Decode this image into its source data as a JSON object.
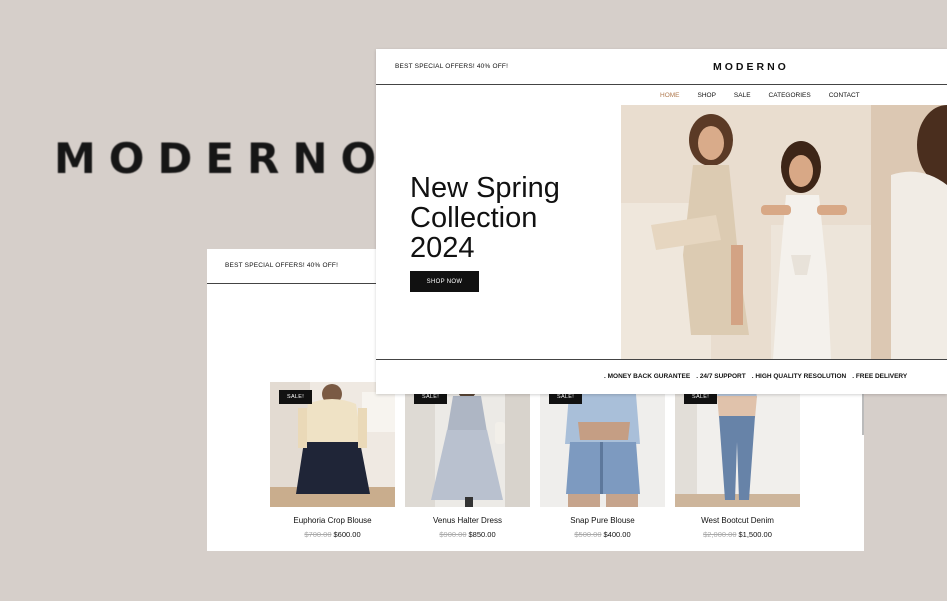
{
  "brand_logo": "MODERNO",
  "back_card": {
    "offer_text": "BEST SPECIAL OFFERS! 40% OFF!",
    "products": [
      {
        "badge": "SALE!",
        "name": "Euphoria Crop Blouse",
        "old_price": "$700.00",
        "price": "$600.00"
      },
      {
        "badge": "SALE!",
        "name": "Venus Halter Dress",
        "old_price": "$900.00",
        "price": "$850.00"
      },
      {
        "badge": "SALE!",
        "name": "Snap Pure Blouse",
        "old_price": "$500.00",
        "price": "$400.00"
      },
      {
        "badge": "SALE!",
        "name": "West Bootcut Denim",
        "old_price": "$2,000.00",
        "price": "$1,500.00"
      }
    ]
  },
  "front_card": {
    "offer_text": "BEST SPECIAL OFFERS! 40% OFF!",
    "brand": "MODERNO",
    "nav": [
      "HOME",
      "SHOP",
      "SALE",
      "CATEGORIES",
      "CONTACT"
    ],
    "nav_active": "HOME",
    "hero_title_lines": [
      "New Spring",
      "Collection",
      "2024"
    ],
    "cta_label": "SHOP NOW",
    "features": [
      ". MONEY BACK GURANTEE",
      ". 24/7 SUPPORT",
      ". HIGH QUALITY RESOLUTION",
      ". FREE DELIVERY"
    ]
  },
  "colors": {
    "background": "#d6cfca",
    "accent_nav": "#b07a4f",
    "button": "#111111",
    "badge": "#111111"
  }
}
